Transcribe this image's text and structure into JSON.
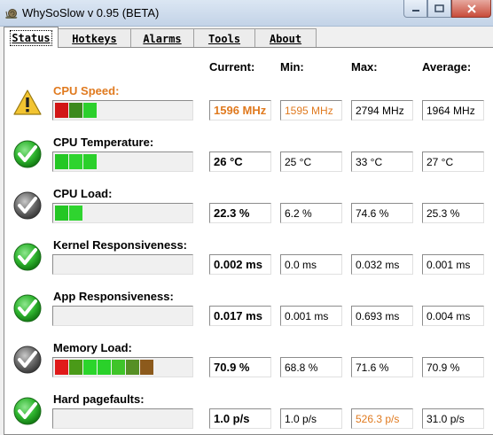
{
  "window": {
    "title": "WhySoSlow v 0.95  (BETA)"
  },
  "tabs": [
    {
      "label": "Status",
      "active": true
    },
    {
      "label": "Hotkeys"
    },
    {
      "label": "Alarms"
    },
    {
      "label": "Tools"
    },
    {
      "label": "About"
    }
  ],
  "headers": {
    "current": "Current:",
    "min": "Min:",
    "max": "Max:",
    "average": "Average:"
  },
  "colors": {
    "warning": "#e07a1f",
    "ok_green": "#2fb52f",
    "neutral_gray": "#6b6b6b"
  },
  "metrics": [
    {
      "label": "CPU Speed:",
      "status": "warning",
      "meter_segments": 3,
      "current": "1596 MHz",
      "min": "1595 MHz",
      "max": "2794 MHz",
      "average": "1964 MHz"
    },
    {
      "label": "CPU Temperature:",
      "status": "ok",
      "meter_segments": 3,
      "current": "26 °C",
      "min": "25 °C",
      "max": "33 °C",
      "average": "27 °C"
    },
    {
      "label": "CPU Load:",
      "status": "neutral",
      "meter_segments": 2,
      "current": "22.3 %",
      "min": "6.2 %",
      "max": "74.6 %",
      "average": "25.3 %"
    },
    {
      "label": "Kernel Responsiveness:",
      "status": "ok",
      "meter_segments": 0,
      "current": "0.002 ms",
      "min": "0.0 ms",
      "max": "0.032 ms",
      "average": "0.001 ms"
    },
    {
      "label": "App Responsiveness:",
      "status": "ok",
      "meter_segments": 0,
      "current": "0.017 ms",
      "min": "0.001 ms",
      "max": "0.693 ms",
      "average": "0.004 ms"
    },
    {
      "label": "Memory Load:",
      "status": "neutral",
      "meter_segments": 7,
      "current": "70.9 %",
      "min": "68.8 %",
      "max": "71.6 %",
      "average": "70.9 %"
    },
    {
      "label": "Hard pagefaults:",
      "status": "ok",
      "meter_segments": 0,
      "current": "1.0 p/s",
      "min": "1.0 p/s",
      "max": "526.3 p/s",
      "average": "31.0 p/s"
    }
  ]
}
